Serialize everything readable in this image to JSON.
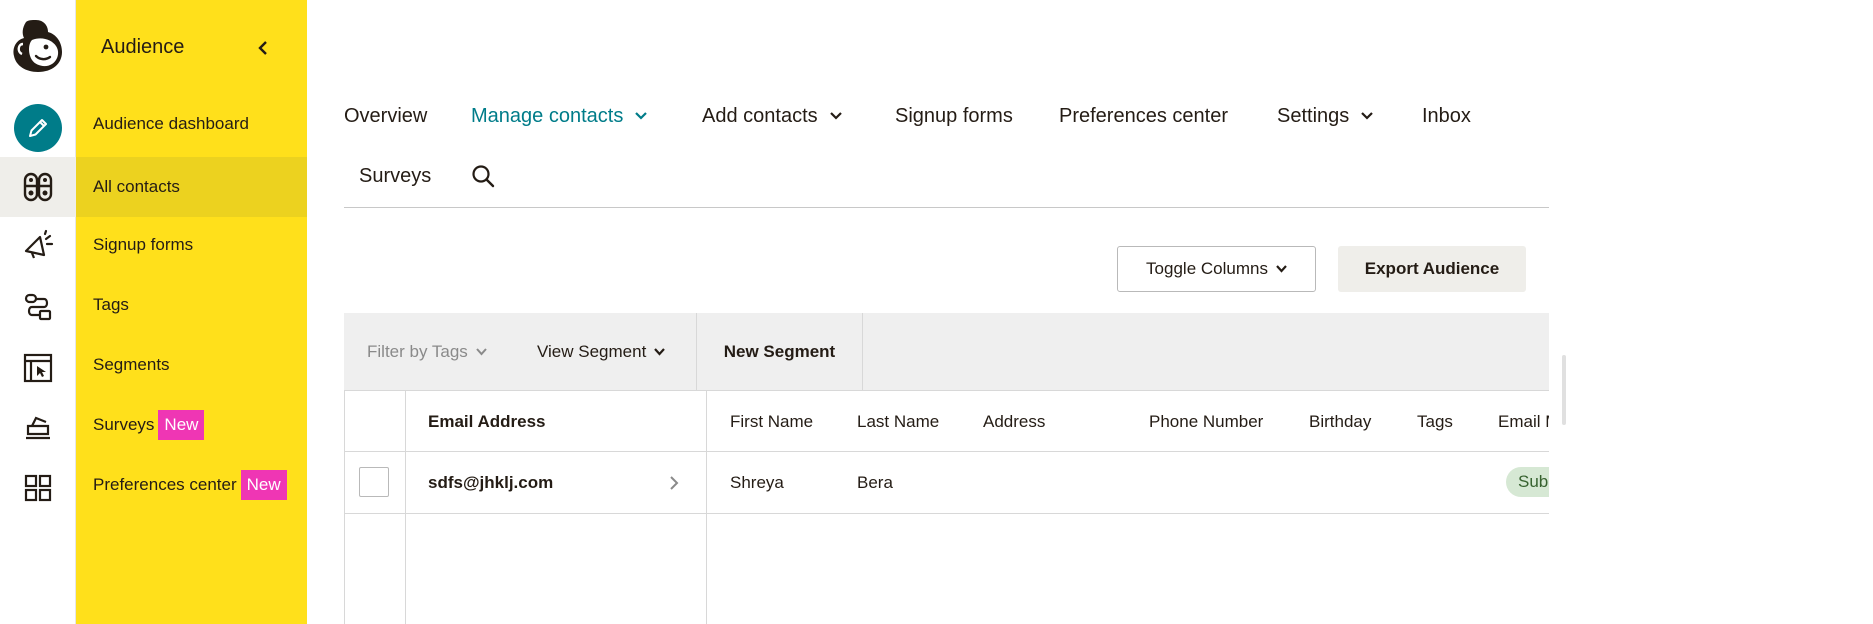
{
  "rail": {
    "items": [
      {
        "icon": "pencil-create-icon"
      },
      {
        "icon": "audience-icon"
      },
      {
        "icon": "campaigns-megaphone-icon"
      },
      {
        "icon": "automations-icon"
      },
      {
        "icon": "website-icon"
      },
      {
        "icon": "content-studio-icon"
      },
      {
        "icon": "integrations-grid-icon"
      }
    ]
  },
  "subnav": {
    "title": "Audience",
    "items": [
      {
        "label": "Audience dashboard"
      },
      {
        "label": "All contacts"
      },
      {
        "label": "Signup forms"
      },
      {
        "label": "Tags"
      },
      {
        "label": "Segments"
      },
      {
        "label": "Surveys",
        "badge": "New"
      },
      {
        "label": "Preferences center",
        "badge": "New"
      }
    ]
  },
  "tabs": [
    {
      "label": "Overview"
    },
    {
      "label": "Manage contacts"
    },
    {
      "label": "Add contacts"
    },
    {
      "label": "Signup forms"
    },
    {
      "label": "Preferences center"
    },
    {
      "label": "Settings"
    },
    {
      "label": "Inbox"
    },
    {
      "label": "Surveys"
    }
  ],
  "actions": {
    "toggle_columns": "Toggle Columns",
    "export_audience": "Export Audience"
  },
  "filters": {
    "filter_by_tags": "Filter by Tags",
    "view_segment": "View Segment",
    "new_segment": "New Segment"
  },
  "table": {
    "columns": [
      "Email Address",
      "First Name",
      "Last Name",
      "Address",
      "Phone Number",
      "Birthday",
      "Tags",
      "Email M"
    ],
    "rows": [
      {
        "email": "sdfs@jhklj.com",
        "first_name": "Shreya",
        "last_name": "Bera",
        "status": "Sub"
      }
    ]
  },
  "colors": {
    "accent": "#007c89",
    "nav_yellow": "#ffe01b",
    "badge_pink": "#ef36b4"
  }
}
